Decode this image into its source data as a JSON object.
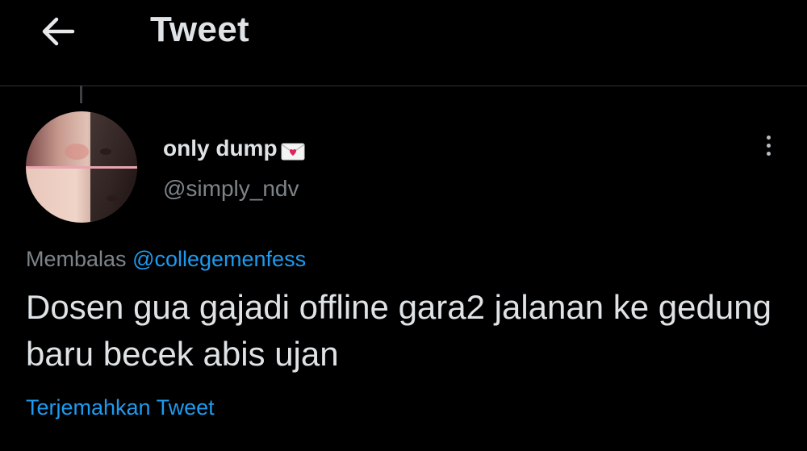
{
  "header": {
    "title": "Tweet",
    "back_icon": "arrow-left-icon"
  },
  "tweet": {
    "author": {
      "name": "only dump",
      "name_emoji": "envelope-heart-icon",
      "handle": "@simply_ndv"
    },
    "reply_prefix": "Membalas",
    "reply_to": "@collegemenfess",
    "text": "Dosen gua gajadi offline gara2 jalanan ke gedung baru becek abis ujan",
    "translate_label": "Terjemahkan Tweet",
    "more_icon": "more-vertical-icon"
  },
  "colors": {
    "background": "#000000",
    "text": "#dfe3e6",
    "muted": "#7d8489",
    "accent": "#1d9bf0",
    "divider": "#2f3336"
  }
}
